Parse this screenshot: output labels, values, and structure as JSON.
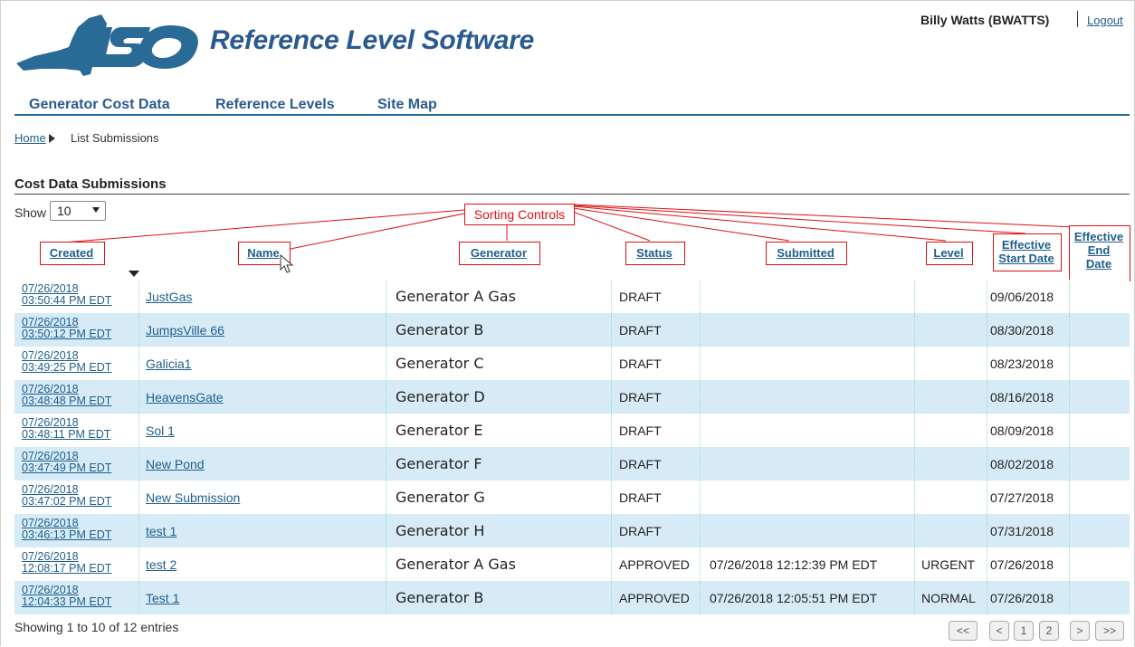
{
  "header": {
    "logo_text": "ISO",
    "app_title": "Reference Level Software",
    "user": "Billy Watts (BWATTS)",
    "logout": "Logout"
  },
  "nav": {
    "items": [
      "Generator Cost Data",
      "Reference Levels",
      "Site Map"
    ]
  },
  "breadcrumb": {
    "home": "Home",
    "current": "List Submissions"
  },
  "section": {
    "title": "Cost Data Submissions",
    "show_label": "Show",
    "show_value": "10",
    "annotation": "Sorting Controls"
  },
  "table": {
    "columns": [
      "Created",
      "Name",
      "Generator",
      "Status",
      "Submitted",
      "Level",
      "Effective Start Date",
      "Effective End Date"
    ],
    "col_eff_start_1": "Effective",
    "col_eff_start_2": "Start Date",
    "col_eff_end_1": "Effective",
    "col_eff_end_2": "End",
    "col_eff_end_3": "Date",
    "rows": [
      {
        "created_date": "07/26/2018",
        "created_time": "03:50:44 PM EDT",
        "name": "JustGas",
        "generator": "Generator A Gas",
        "status": "DRAFT",
        "submitted": "",
        "level": "",
        "eff_start": "09/06/2018",
        "eff_end": ""
      },
      {
        "created_date": "07/26/2018",
        "created_time": "03:50:12 PM EDT",
        "name": "JumpsVille 66",
        "generator": "Generator B",
        "status": "DRAFT",
        "submitted": "",
        "level": "",
        "eff_start": "08/30/2018",
        "eff_end": ""
      },
      {
        "created_date": "07/26/2018",
        "created_time": "03:49:25 PM EDT",
        "name": "Galicia1",
        "generator": "Generator C",
        "status": "DRAFT",
        "submitted": "",
        "level": "",
        "eff_start": "08/23/2018",
        "eff_end": ""
      },
      {
        "created_date": "07/26/2018",
        "created_time": "03:48:48 PM EDT",
        "name": "HeavensGate",
        "generator": "Generator D",
        "status": "DRAFT",
        "submitted": "",
        "level": "",
        "eff_start": "08/16/2018",
        "eff_end": ""
      },
      {
        "created_date": "07/26/2018",
        "created_time": "03:48:11 PM EDT",
        "name": "Sol 1",
        "generator": "Generator E",
        "status": "DRAFT",
        "submitted": "",
        "level": "",
        "eff_start": "08/09/2018",
        "eff_end": ""
      },
      {
        "created_date": "07/26/2018",
        "created_time": "03:47:49 PM EDT",
        "name": "New Pond",
        "generator": "Generator F",
        "status": "DRAFT",
        "submitted": "",
        "level": "",
        "eff_start": "08/02/2018",
        "eff_end": ""
      },
      {
        "created_date": "07/26/2018",
        "created_time": "03:47:02 PM EDT",
        "name": "New Submission",
        "generator": "Generator G",
        "status": "DRAFT",
        "submitted": "",
        "level": "",
        "eff_start": "07/27/2018",
        "eff_end": ""
      },
      {
        "created_date": "07/26/2018",
        "created_time": "03:46:13 PM EDT",
        "name": "test 1",
        "generator": "Generator H",
        "status": "DRAFT",
        "submitted": "",
        "level": "",
        "eff_start": "07/31/2018",
        "eff_end": ""
      },
      {
        "created_date": "07/26/2018",
        "created_time": "12:08:17 PM EDT",
        "name": "test 2",
        "generator": "Generator A Gas",
        "status": "APPROVED",
        "submitted": "07/26/2018 12:12:39 PM EDT",
        "level": "URGENT",
        "eff_start": "07/26/2018",
        "eff_end": ""
      },
      {
        "created_date": "07/26/2018",
        "created_time": "12:04:33 PM EDT",
        "name": "Test 1",
        "generator": "Generator B",
        "status": "APPROVED",
        "submitted": "07/26/2018 12:05:51 PM EDT",
        "level": "NORMAL",
        "eff_start": "07/26/2018",
        "eff_end": ""
      }
    ]
  },
  "footer": {
    "showing": "Showing 1 to 10 of 12 entries",
    "pager": [
      "<<",
      "<",
      "1",
      "2",
      ">",
      ">>"
    ]
  }
}
